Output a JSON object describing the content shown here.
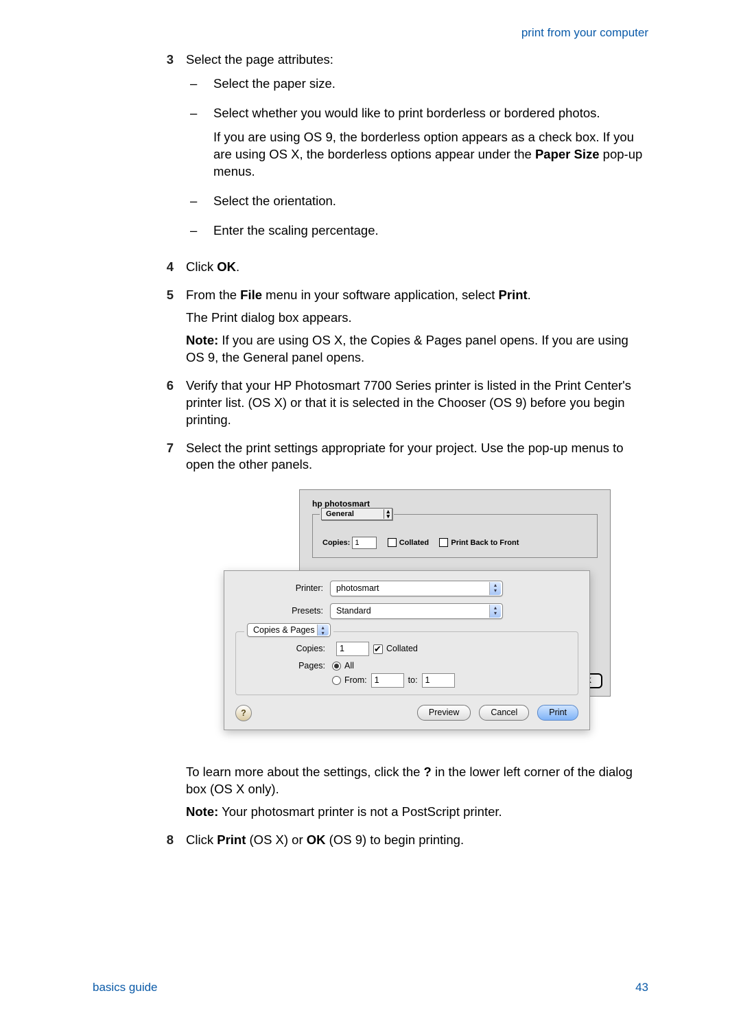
{
  "header": {
    "section_link": "print from your computer"
  },
  "steps": {
    "s3": {
      "num": "3",
      "text": "Select the page attributes:",
      "sub": {
        "a": "Select the paper size.",
        "b": "Select whether you would like to print borderless or bordered photos.",
        "b_extra_pre": "If you are using OS 9, the borderless option appears as a check box. If you are using OS X, the borderless options appear under the ",
        "b_extra_bold": "Paper Size",
        "b_extra_post": " pop-up menus.",
        "c": "Select the orientation.",
        "d": "Enter the scaling percentage."
      }
    },
    "s4": {
      "num": "4",
      "pre": "Click ",
      "bold": "OK",
      "post": "."
    },
    "s5": {
      "num": "5",
      "l1_pre": "From the ",
      "l1_b1": "File",
      "l1_mid": " menu in your software application, select ",
      "l1_b2": "Print",
      "l1_post": ".",
      "l2": "The Print dialog box appears.",
      "l3_b": "Note:",
      "l3_t": "  If you are using OS X, the Copies & Pages panel opens. If you are using OS 9, the General panel opens."
    },
    "s6": {
      "num": "6",
      "text": "Verify that your HP Photosmart 7700 Series printer is listed in the Print Center's printer list. (OS X) or that it is selected in the Chooser (OS 9) before you begin printing."
    },
    "s7": {
      "num": "7",
      "text": "Select the print settings appropriate for your project. Use the pop-up menus to open the other panels."
    },
    "after7a_pre": "To learn more about the settings, click the ",
    "after7a_b": "?",
    "after7a_post": " in the lower left corner of the dialog box (OS X only).",
    "after7b_b": "Note:",
    "after7b_t": "  Your photosmart printer is not a PostScript printer.",
    "s8": {
      "num": "8",
      "pre": "Click ",
      "b1": "Print",
      "mid": " (OS X) or ",
      "b2": "OK",
      "post": " (OS 9) to begin printing."
    }
  },
  "dlg9": {
    "brand": "hp photosmart",
    "general": "General",
    "copies_label": "Copies:",
    "copies_val": "1",
    "collated": "Collated",
    "back_to_front": "Print Back to Front",
    "ok": "OK"
  },
  "dlgx": {
    "printer_label": "Printer:",
    "printer_val": "photosmart",
    "presets_label": "Presets:",
    "presets_val": "Standard",
    "panel": "Copies & Pages",
    "copies_label": "Copies:",
    "copies_val": "1",
    "collated": "Collated",
    "pages_label": "Pages:",
    "all": "All",
    "from": "From:",
    "from_val": "1",
    "to": "to:",
    "to_val": "1",
    "help": "?",
    "preview": "Preview",
    "cancel": "Cancel",
    "print": "Print"
  },
  "footer": {
    "guide": "basics guide",
    "page": "43"
  }
}
